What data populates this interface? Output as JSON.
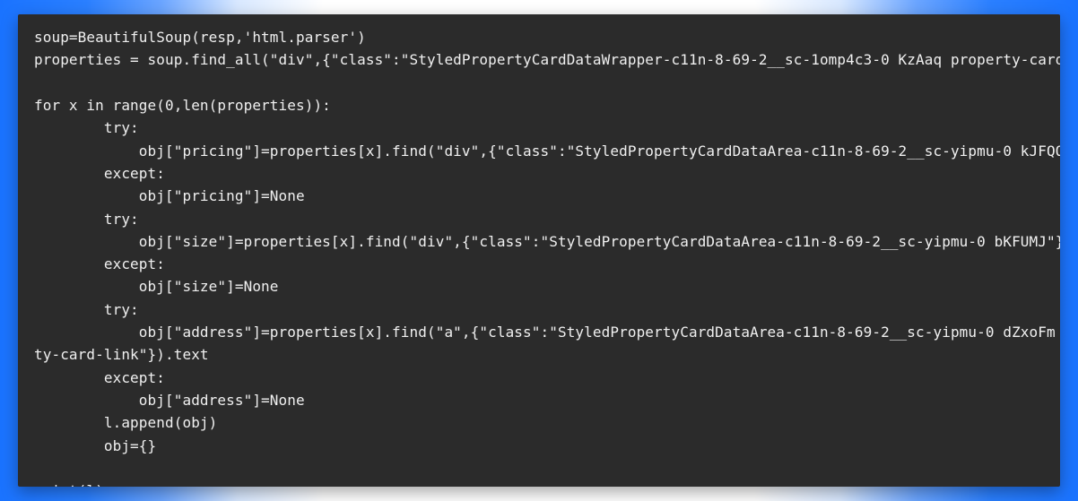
{
  "code": {
    "lines": [
      "soup=BeautifulSoup(resp,'html.parser')",
      "properties = soup.find_all(\"div\",{\"class\":\"StyledPropertyCardDataWrapper-c11n-8-69-2__sc-1omp4c3-0 KzAaq property-card-data\"})",
      "",
      "for x in range(0,len(properties)):",
      "        try:",
      "            obj[\"pricing\"]=properties[x].find(\"div\",{\"class\":\"StyledPropertyCardDataArea-c11n-8-69-2__sc-yipmu-0 kJFQQX\"}).text",
      "        except:",
      "            obj[\"pricing\"]=None",
      "        try:",
      "            obj[\"size\"]=properties[x].find(\"div\",{\"class\":\"StyledPropertyCardDataArea-c11n-8-69-2__sc-yipmu-0 bKFUMJ\"}).text",
      "        except:",
      "            obj[\"size\"]=None",
      "        try:",
      "            obj[\"address\"]=properties[x].find(\"a\",{\"class\":\"StyledPropertyCardDataArea-c11n-8-69-2__sc-yipmu-0 dZxoFm proper-",
      "ty-card-link\"}).text",
      "        except:",
      "            obj[\"address\"]=None",
      "        l.append(obj)",
      "        obj={}",
      "",
      "print(l)"
    ]
  }
}
